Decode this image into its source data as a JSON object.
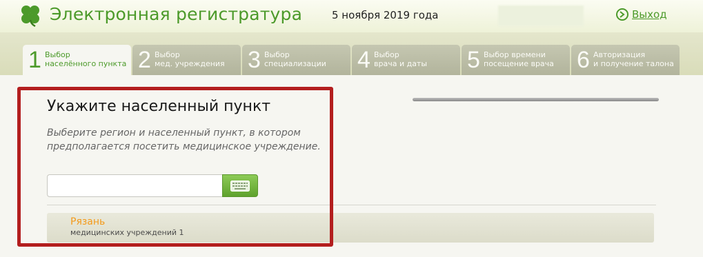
{
  "header": {
    "app_title": "Электронная регистратура",
    "date": "5 ноября 2019 года",
    "exit_label": "Выход",
    "logo_icon": "clover-icon",
    "exit_icon": "exit-icon",
    "brand_color": "#4c9a2a"
  },
  "steps": [
    {
      "num": "1",
      "line1": "Выбор",
      "line2": "населённого пункта",
      "active": true
    },
    {
      "num": "2",
      "line1": "Выбор",
      "line2": "мед. учреждения",
      "active": false
    },
    {
      "num": "3",
      "line1": "Выбор",
      "line2": "специализации",
      "active": false
    },
    {
      "num": "4",
      "line1": "Выбор",
      "line2": "врача и даты",
      "active": false
    },
    {
      "num": "5",
      "line1": "Выбор времени",
      "line2": "посещение врача",
      "active": false
    },
    {
      "num": "6",
      "line1": "Авторизация",
      "line2": "и получение талона",
      "active": false
    }
  ],
  "main": {
    "heading": "Укажите населенный пункт",
    "hint_line1": "Выберите регион и населенный пункт, в котором",
    "hint_line2": "предполагается посетить медицинское учреждение.",
    "search_value": "",
    "keyboard_icon": "keyboard-icon",
    "results": [
      {
        "city": "Рязань",
        "subtitle": "медицинских учреждений 1"
      }
    ]
  },
  "colors": {
    "highlight": "#b31e1e",
    "city": "#f39a1a"
  }
}
